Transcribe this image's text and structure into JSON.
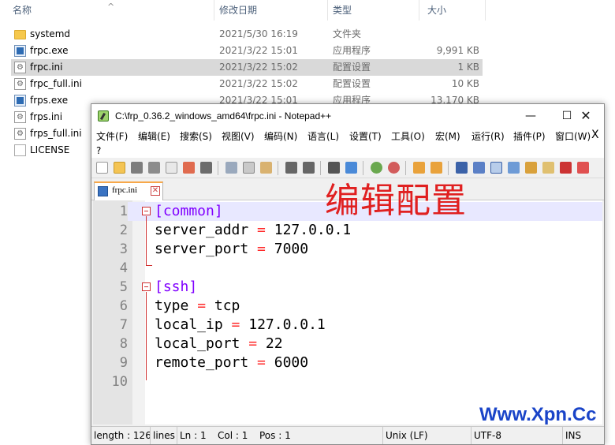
{
  "explorer": {
    "columns": {
      "name": "名称",
      "date": "修改日期",
      "type": "类型",
      "size": "大小"
    },
    "files": [
      {
        "name": "systemd",
        "date": "2021/5/30 16:19",
        "type": "文件夹",
        "size": "",
        "icon": "folder-icon"
      },
      {
        "name": "frpc.exe",
        "date": "2021/3/22 15:01",
        "type": "应用程序",
        "size": "9,991 KB",
        "icon": "exe-icon"
      },
      {
        "name": "frpc.ini",
        "date": "2021/3/22 15:02",
        "type": "配置设置",
        "size": "1 KB",
        "icon": "ini-icon",
        "selected": true
      },
      {
        "name": "frpc_full.ini",
        "date": "2021/3/22 15:02",
        "type": "配置设置",
        "size": "10 KB",
        "icon": "ini-icon"
      },
      {
        "name": "frps.exe",
        "date": "2021/3/22 15:01",
        "type": "应用程序",
        "size": "13,170 KB",
        "icon": "exe-icon"
      },
      {
        "name": "frps.ini",
        "date": "",
        "type": "",
        "size": "",
        "icon": "ini-icon"
      },
      {
        "name": "frps_full.ini",
        "date": "",
        "type": "",
        "size": "",
        "icon": "ini-icon"
      },
      {
        "name": "LICENSE",
        "date": "",
        "type": "",
        "size": "",
        "icon": "file-icon"
      }
    ]
  },
  "notepad": {
    "title": "C:\\frp_0.36.2_windows_amd64\\frpc.ini - Notepad++",
    "window_buttons": {
      "minimize": "—",
      "maximize": "☐",
      "close": "✕"
    },
    "menu": [
      "文件(F)",
      "编辑(E)",
      "搜索(S)",
      "视图(V)",
      "编码(N)",
      "语言(L)",
      "设置(T)",
      "工具(O)",
      "宏(M)",
      "运行(R)",
      "插件(P)",
      "窗口(W)"
    ],
    "menu_help": "?",
    "menu_close": "X",
    "tab": {
      "label": "frpc.ini",
      "close": "✕"
    },
    "lines": [
      {
        "num": "1",
        "parts": [
          {
            "t": "[common]",
            "c": "sect"
          }
        ]
      },
      {
        "num": "2",
        "parts": [
          {
            "t": "server_addr ",
            "c": "key"
          },
          {
            "t": "=",
            "c": "op"
          },
          {
            "t": " 127.0.0.1",
            "c": "val"
          }
        ]
      },
      {
        "num": "3",
        "parts": [
          {
            "t": "server_port ",
            "c": "key"
          },
          {
            "t": "=",
            "c": "op"
          },
          {
            "t": " 7000",
            "c": "val"
          }
        ]
      },
      {
        "num": "4",
        "parts": []
      },
      {
        "num": "5",
        "parts": [
          {
            "t": "[ssh]",
            "c": "sect"
          }
        ]
      },
      {
        "num": "6",
        "parts": [
          {
            "t": "type ",
            "c": "key"
          },
          {
            "t": "=",
            "c": "op"
          },
          {
            "t": " tcp",
            "c": "val"
          }
        ]
      },
      {
        "num": "7",
        "parts": [
          {
            "t": "local_ip ",
            "c": "key"
          },
          {
            "t": "=",
            "c": "op"
          },
          {
            "t": " 127.0.0.1",
            "c": "val"
          }
        ]
      },
      {
        "num": "8",
        "parts": [
          {
            "t": "local_port ",
            "c": "key"
          },
          {
            "t": "=",
            "c": "op"
          },
          {
            "t": " 22",
            "c": "val"
          }
        ]
      },
      {
        "num": "9",
        "parts": [
          {
            "t": "remote_port ",
            "c": "key"
          },
          {
            "t": "=",
            "c": "op"
          },
          {
            "t": " 6000",
            "c": "val"
          }
        ]
      },
      {
        "num": "10",
        "parts": []
      }
    ],
    "annotation": "编辑配置",
    "status": {
      "length": "length : 126",
      "lines": "lines",
      "ln": "Ln : 1",
      "col": "Col : 1",
      "pos": "Pos : 1",
      "eol": "Unix (LF)",
      "encoding": "UTF-8",
      "mode": "INS"
    }
  },
  "watermark": "Www.Xpn.Cc",
  "colors": {
    "section": "#8000ff",
    "operator": "#ff2a2a",
    "fold_marker": "#d03030",
    "current_line": "#e8e8ff",
    "annotation": "#e02020",
    "watermark": "#1a44c8",
    "tab_accent": "#f7a84a"
  }
}
